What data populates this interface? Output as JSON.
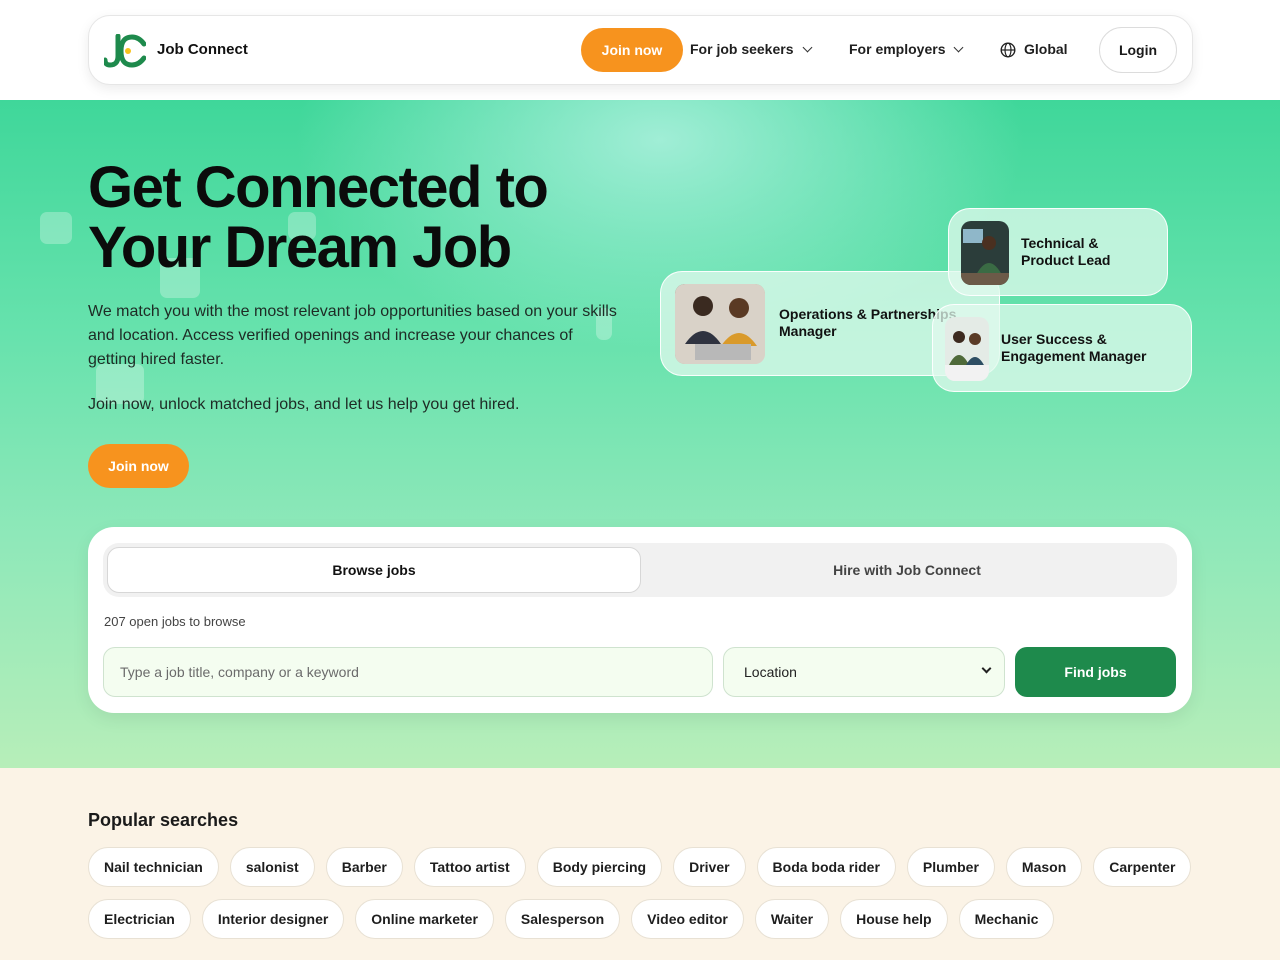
{
  "nav": {
    "brand": "Job Connect",
    "join_label": "Join now",
    "job_seekers_label": "For job seekers",
    "employers_label": "For employers",
    "global_label": "Global",
    "login_label": "Login"
  },
  "hero": {
    "title": "Get Connected to Your Dream Job",
    "description": "We match you with the most relevant job opportunities based on your skills and location. Access verified openings and increase your chances of getting hired faster.",
    "subtext": "Join now, unlock matched jobs, and let us help you get hired.",
    "join_label": "Join now",
    "job_cards": [
      {
        "title": "Operations & Partnerships Manager"
      },
      {
        "title": "Technical & Product Lead"
      },
      {
        "title": "User Success & Engagement Manager"
      }
    ]
  },
  "search": {
    "tabs": [
      {
        "label": "Browse jobs",
        "active": true
      },
      {
        "label": "Hire with Job Connect",
        "active": false
      }
    ],
    "open_count": "207 open jobs to browse",
    "input_placeholder": "Type a job title, company or a keyword",
    "location_label": "Location",
    "find_label": "Find jobs"
  },
  "popular": {
    "title": "Popular searches",
    "chips": [
      "Nail technician",
      "salonist",
      "Barber",
      "Tattoo artist",
      "Body piercing",
      "Driver",
      "Boda boda rider",
      "Plumber",
      "Mason",
      "Carpenter",
      "Electrician",
      "Interior designer",
      "Online marketer",
      "Salesperson",
      "Video editor",
      "Waiter",
      "House help",
      "Mechanic"
    ]
  },
  "colors": {
    "accent_orange": "#f7931e",
    "primary_green": "#1e8a4c",
    "hero_green": "#3fd79a",
    "page_cream": "#fbf3e6"
  }
}
